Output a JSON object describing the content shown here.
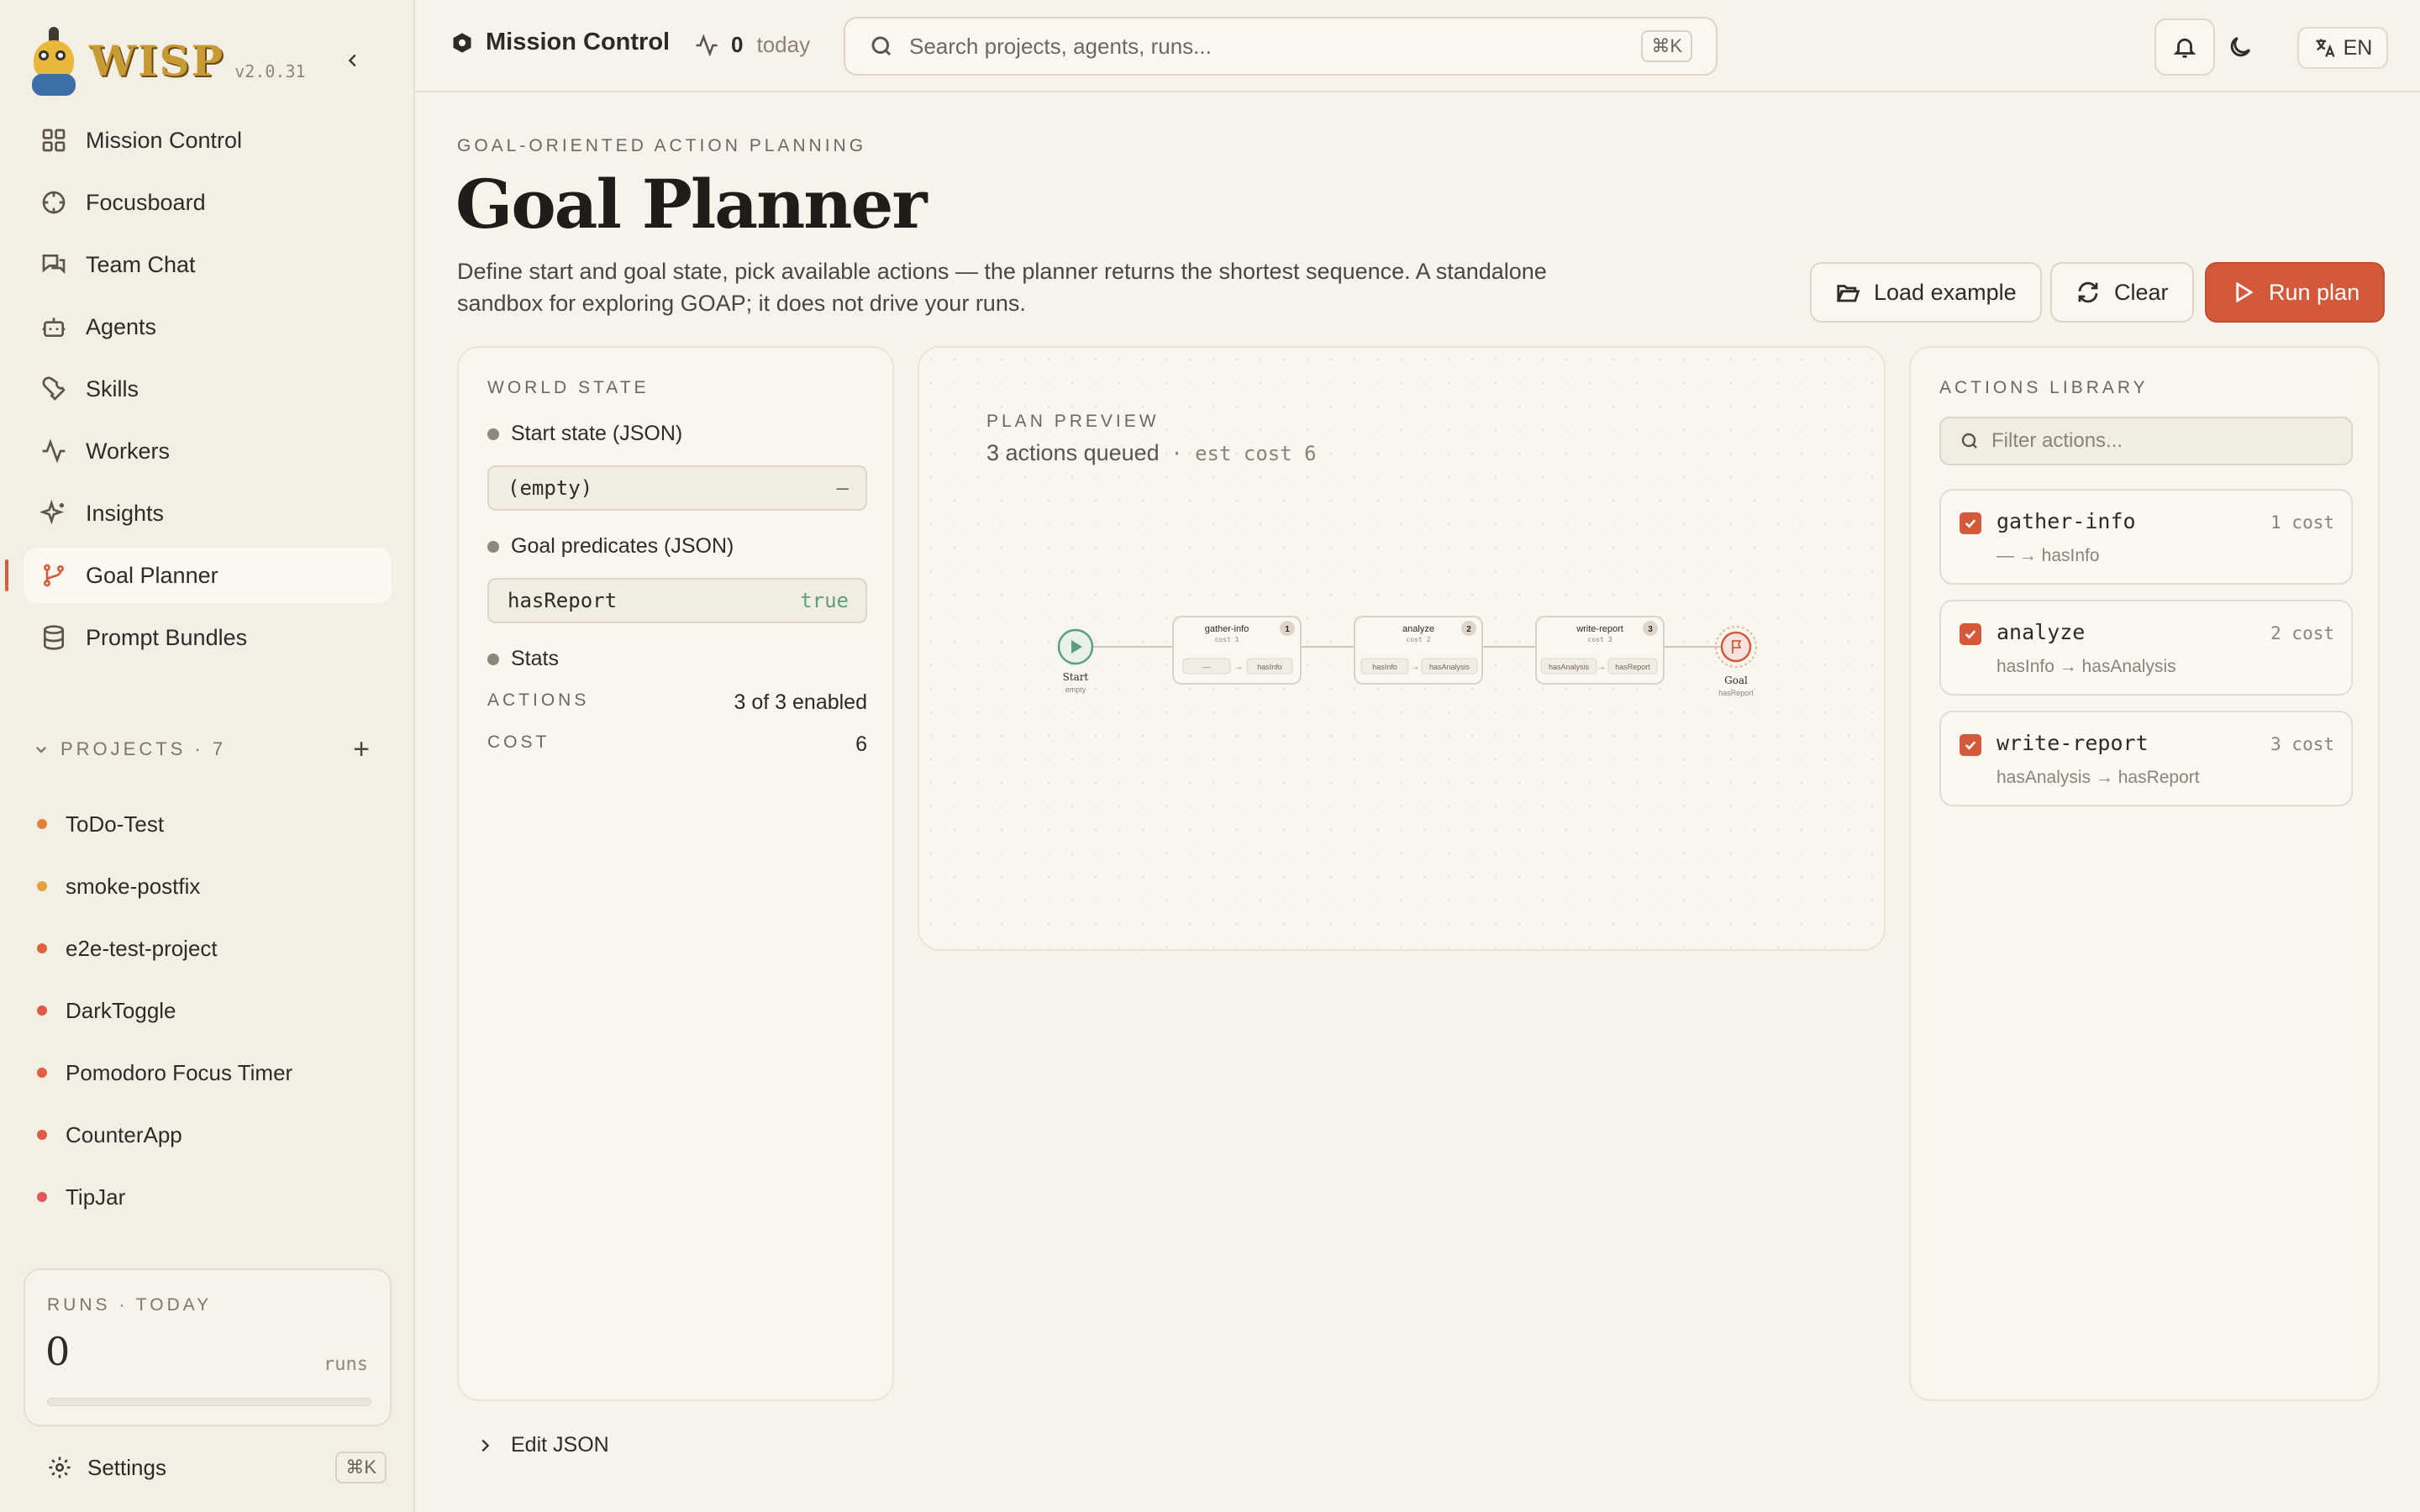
{
  "app": {
    "name": "WISP",
    "version": "v2.0.31"
  },
  "nav": [
    {
      "label": "Mission Control",
      "icon": "grid-icon"
    },
    {
      "label": "Focusboard",
      "icon": "target-icon"
    },
    {
      "label": "Team Chat",
      "icon": "chat-icon"
    },
    {
      "label": "Agents",
      "icon": "bot-icon"
    },
    {
      "label": "Skills",
      "icon": "wrench-icon"
    },
    {
      "label": "Workers",
      "icon": "activity-icon"
    },
    {
      "label": "Insights",
      "icon": "sparkles-icon"
    },
    {
      "label": "Goal Planner",
      "icon": "branch-icon",
      "active": true
    },
    {
      "label": "Prompt Bundles",
      "icon": "database-icon"
    }
  ],
  "projects": {
    "title": "PROJECTS · 7",
    "items": [
      {
        "label": "ToDo-Test",
        "color": "#e0823f"
      },
      {
        "label": "smoke-postfix",
        "color": "#e0a33f"
      },
      {
        "label": "e2e-test-project",
        "color": "#e0603f"
      },
      {
        "label": "DarkToggle",
        "color": "#e05a4a"
      },
      {
        "label": "Pomodoro Focus Timer",
        "color": "#e0603f"
      },
      {
        "label": "CounterApp",
        "color": "#e05a4a"
      },
      {
        "label": "TipJar",
        "color": "#e05a5a"
      }
    ]
  },
  "runs_today": {
    "label": "RUNS · TODAY",
    "count": "0",
    "unit": "runs",
    "progress": 0
  },
  "settings": {
    "label": "Settings",
    "shortcut": "⌘K"
  },
  "topbar": {
    "title": "Mission Control",
    "today_count": "0",
    "today_label": "today",
    "search_placeholder": "Search projects, agents, runs...",
    "search_shortcut": "⌘K",
    "lang": "EN"
  },
  "page": {
    "eyebrow": "GOAL-ORIENTED ACTION PLANNING",
    "title": "Goal Planner",
    "description": "Define start and goal state, pick available actions — the planner returns the shortest sequence. A standalone sandbox for exploring GOAP; it does not drive your runs.",
    "buttons": {
      "load": "Load example",
      "clear": "Clear",
      "run": "Run plan"
    }
  },
  "world_state": {
    "title": "WORLD STATE",
    "start_label": "Start state (JSON)",
    "start_value": "(empty)",
    "start_suffix": "—",
    "goal_label": "Goal predicates (JSON)",
    "goal_key": "hasReport",
    "goal_value": "true",
    "stats_label": "Stats",
    "actions_key": "ACTIONS",
    "actions_value": "3 of 3 enabled",
    "cost_key": "COST",
    "cost_value": "6"
  },
  "plan_preview": {
    "title": "PLAN PREVIEW",
    "summary": "3 actions queued",
    "cost": "· est cost 6",
    "start": {
      "label": "Start",
      "sub": "empty"
    },
    "goal": {
      "label": "Goal",
      "sub": "hasReport"
    },
    "steps": [
      {
        "name": "gather-info",
        "cost": "cost 1",
        "num": "1",
        "pre": "—",
        "eff": "hasInfo"
      },
      {
        "name": "analyze",
        "cost": "cost 2",
        "num": "2",
        "pre": "hasInfo",
        "eff": "hasAnalysis"
      },
      {
        "name": "write-report",
        "cost": "cost 3",
        "num": "3",
        "pre": "hasAnalysis",
        "eff": "hasReport"
      }
    ]
  },
  "library": {
    "title": "ACTIONS LIBRARY",
    "filter_placeholder": "Filter actions...",
    "actions": [
      {
        "name": "gather-info",
        "cost": "1 cost",
        "effect": "— → hasInfo",
        "checked": true
      },
      {
        "name": "analyze",
        "cost": "2 cost",
        "effect": "hasInfo → hasAnalysis",
        "checked": true
      },
      {
        "name": "write-report",
        "cost": "3 cost",
        "effect": "hasAnalysis → hasReport",
        "checked": true
      }
    ]
  },
  "edit_json": "Edit JSON",
  "colors": {
    "accent": "#d4593a",
    "background": "#f7f3ea",
    "start_node": "#5e9f7f"
  }
}
